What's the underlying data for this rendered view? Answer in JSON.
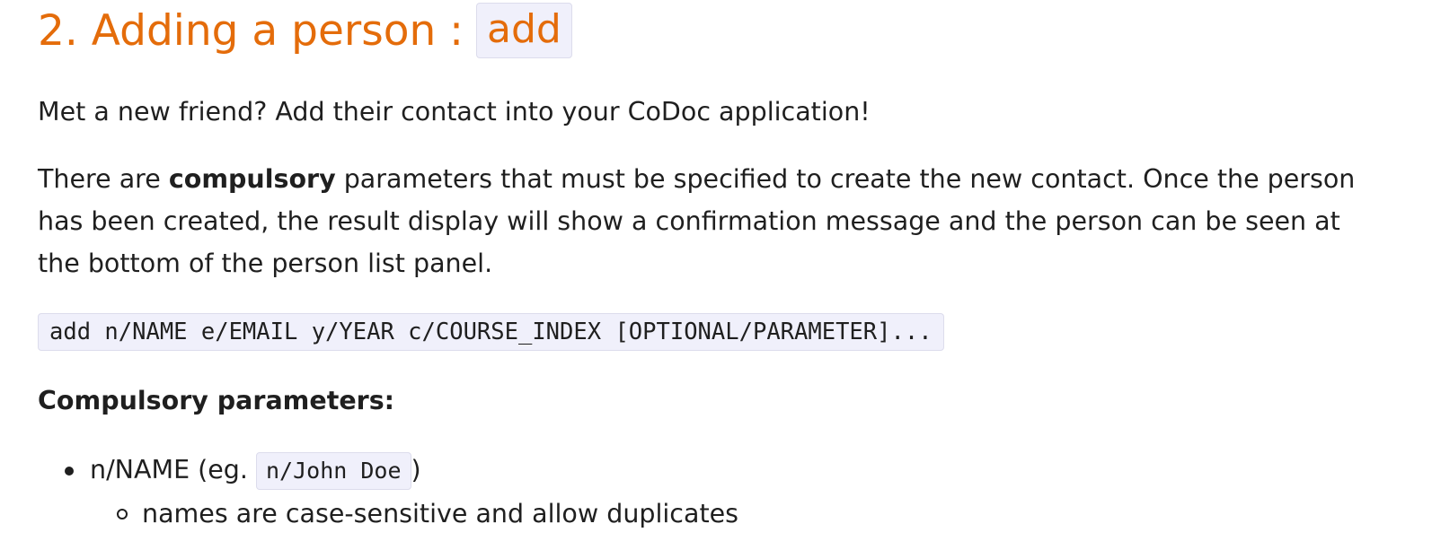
{
  "heading": {
    "text": "2. Adding a person :",
    "command": "add",
    "color": "#e46c0a"
  },
  "intro": "Met a new friend? Add their contact into your CoDoc application!",
  "description": {
    "prefix": "There are ",
    "bold": "compulsory",
    "suffix": " parameters that must be specified to create the new contact. Once the person has been created, the result display will show a confirmation message and the person can be seen at the bottom of the person list panel."
  },
  "command_format": "add n/NAME e/EMAIL y/YEAR c/COURSE_INDEX [OPTIONAL/PARAMETER]...",
  "compulsory_title": "Compulsory parameters:",
  "params": [
    {
      "label_prefix": "n/NAME (eg. ",
      "example": "n/John Doe",
      "label_suffix": ")",
      "sub": [
        "names are case-sensitive and allow duplicates"
      ]
    }
  ]
}
